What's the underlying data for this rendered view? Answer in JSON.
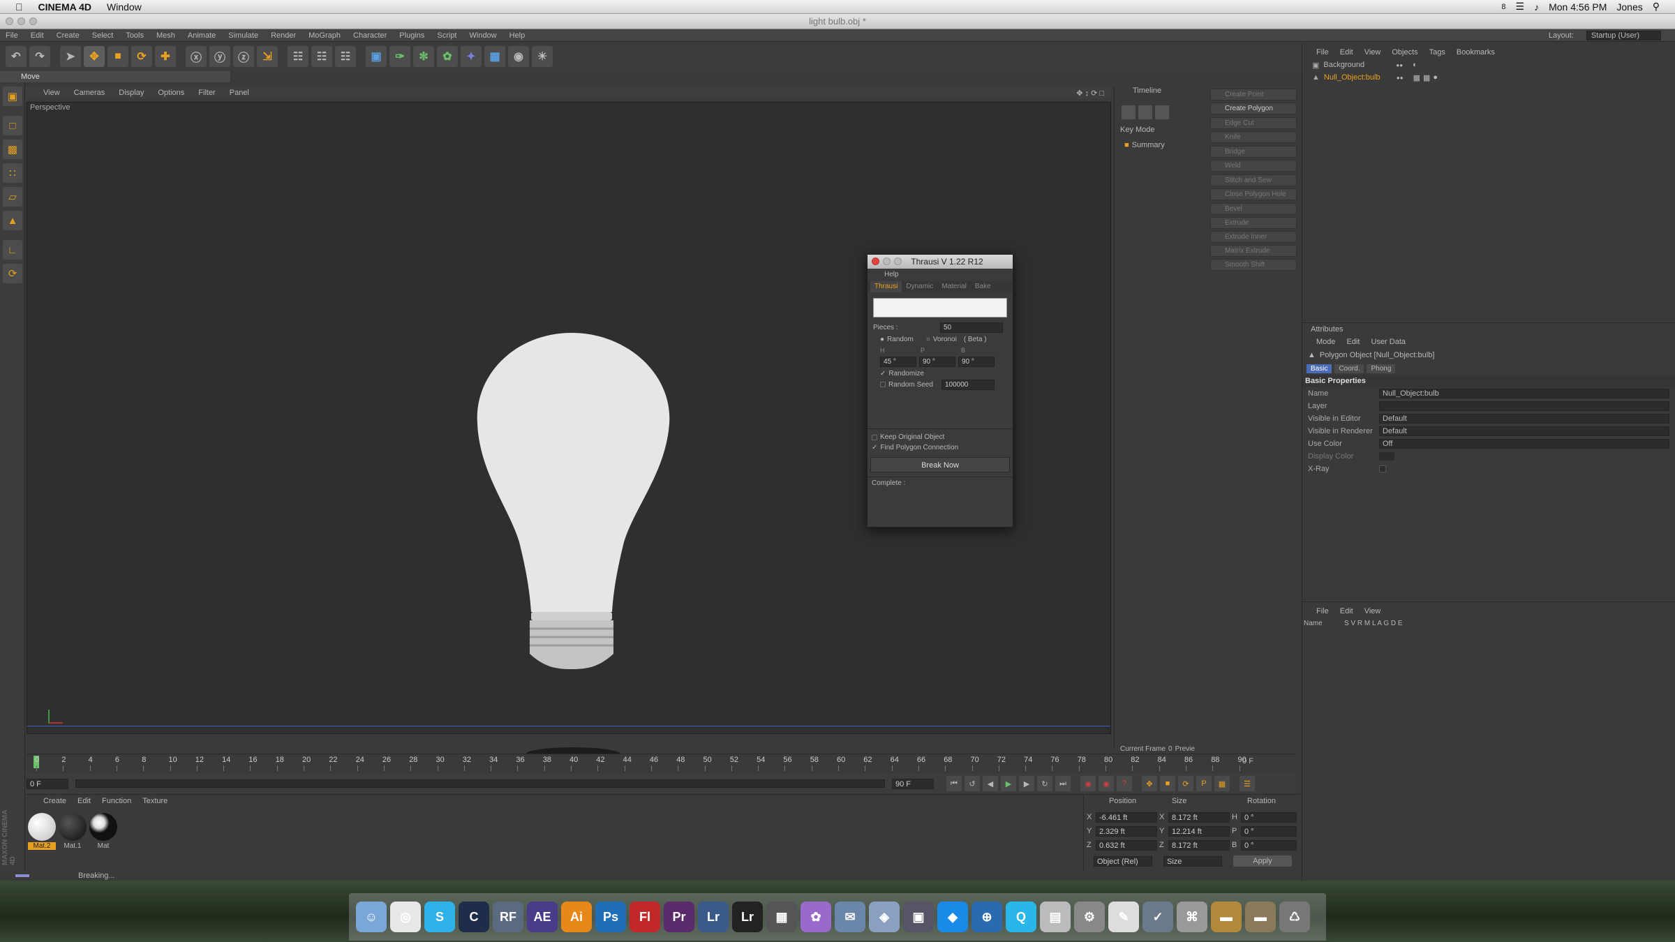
{
  "mac_menubar": {
    "app_name": "CINEMA 4D",
    "window_menu": "Window",
    "time": "Mon 4:56 PM",
    "user": "Jones",
    "badge": "8"
  },
  "window": {
    "title": "light bulb.obj *"
  },
  "app_menu": [
    "File",
    "Edit",
    "Create",
    "Select",
    "Tools",
    "Mesh",
    "Animate",
    "Simulate",
    "Render",
    "MoGraph",
    "Character",
    "Plugins",
    "Script",
    "Window",
    "Help"
  ],
  "layout": {
    "label": "Layout:",
    "value": "Startup (User)"
  },
  "move_label": "Move",
  "viewport": {
    "menu": [
      "View",
      "Cameras",
      "Display",
      "Options",
      "Filter",
      "Panel"
    ],
    "label": "Perspective"
  },
  "timeline_panel": {
    "title": "Timeline",
    "key_mode": "Key Mode",
    "summary": "Summary",
    "current_frame_label": "Current Frame",
    "current_frame_value": "0",
    "preview_label": "Previe"
  },
  "create_panel": {
    "items": [
      "Create Point",
      "Create Polygon",
      "Edge Cut",
      "Knife",
      "Bridge",
      "Weld",
      "Stitch and Sew",
      "Close Polygon Hole",
      "Bevel",
      "Extrude",
      "Extrude Inner",
      "Matrix Extrude",
      "Smooth Shift"
    ]
  },
  "object_manager": {
    "menu": [
      "File",
      "Edit",
      "View",
      "Objects",
      "Tags",
      "Bookmarks"
    ],
    "objects": [
      {
        "name": "Background",
        "selected": false
      },
      {
        "name": "Null_Object:bulb",
        "selected": true
      }
    ]
  },
  "attributes": {
    "title": "Attributes",
    "menu": [
      "Mode",
      "Edit",
      "User Data"
    ],
    "object_label": "Polygon Object [Null_Object:bulb]",
    "tabs": [
      "Basic",
      "Coord.",
      "Phong"
    ],
    "section": "Basic Properties",
    "rows": [
      {
        "label": "Name",
        "value": "Null_Object:bulb"
      },
      {
        "label": "Layer",
        "value": ""
      },
      {
        "label": "Visible in Editor",
        "value": "Default"
      },
      {
        "label": "Visible in Renderer",
        "value": "Default"
      },
      {
        "label": "Use Color",
        "value": "Off"
      },
      {
        "label": "Display Color",
        "value": ""
      },
      {
        "label": "X-Ray",
        "value": ""
      }
    ]
  },
  "layers": {
    "menu": [
      "File",
      "Edit",
      "View"
    ],
    "name_label": "Name",
    "cols": "S V R M L A G D E"
  },
  "timeline": {
    "ticks": [
      "0",
      "2",
      "4",
      "6",
      "8",
      "10",
      "12",
      "14",
      "16",
      "18",
      "20",
      "22",
      "24",
      "26",
      "28",
      "30",
      "32",
      "34",
      "36",
      "38",
      "40",
      "42",
      "44",
      "46",
      "48",
      "50",
      "52",
      "54",
      "56",
      "58",
      "60",
      "62",
      "64",
      "66",
      "68",
      "70",
      "72",
      "74",
      "76",
      "78",
      "80",
      "82",
      "84",
      "86",
      "88",
      "90"
    ],
    "end_frame": "0 F",
    "start_field": "0 F",
    "end_field": "90 F",
    "range_end": "90 F"
  },
  "material_panel": {
    "menu": [
      "Create",
      "Edit",
      "Function",
      "Texture"
    ],
    "materials": [
      {
        "name": "Mat.2",
        "color": "#d8d8d6",
        "selected": true
      },
      {
        "name": "Mat.1",
        "color": "#1a1a1a",
        "selected": false
      },
      {
        "name": "Mat",
        "color": "#2a2a2a",
        "selected": false
      }
    ]
  },
  "coordinates": {
    "headers": [
      "Position",
      "Size",
      "Rotation"
    ],
    "rows": [
      {
        "axis": "X",
        "pos": "-6.461 ft",
        "saxis": "X",
        "size": "8.172 ft",
        "raxis": "H",
        "rot": "0 °"
      },
      {
        "axis": "Y",
        "pos": "2.329 ft",
        "saxis": "Y",
        "size": "12.214 ft",
        "raxis": "P",
        "rot": "0 °"
      },
      {
        "axis": "Z",
        "pos": "0.632 ft",
        "saxis": "Z",
        "size": "8.172 ft",
        "raxis": "B",
        "rot": "0 °"
      }
    ],
    "mode_select": "Object (Rel)",
    "size_select": "Size",
    "apply": "Apply"
  },
  "status_text": "Breaking...",
  "maxon": "MAXON CINEMA 4D",
  "dialog": {
    "title": "Thrausi V 1.22 R12",
    "menu": "Help",
    "tabs": [
      "Thrausi",
      "Dynamic",
      "Material",
      "Bake"
    ],
    "pieces_label": "Pieces :",
    "pieces_value": "50",
    "random_label": "Random",
    "voronoi_label": "Voronoi",
    "beta_label": "( Beta )",
    "hpb_labels": [
      "H",
      "P",
      "B"
    ],
    "hpb_values": [
      "45 °",
      "90 °",
      "90 °"
    ],
    "randomize_label": "Randomize",
    "random_seed_label": "Random Seed",
    "random_seed_value": "100000",
    "keep_original": "Keep Original Object",
    "find_polygon": "Find Polygon Connection",
    "break_now": "Break Now",
    "complete_label": "Complete :"
  },
  "dock": [
    "Finder",
    "Chrome",
    "Skype",
    "Cinema 4D",
    "RF",
    "AE",
    "Ai",
    "Ps",
    "Fl",
    "Pr",
    "Lr",
    "Lr",
    "Clapper",
    "Colors",
    "Mail",
    "Preview",
    "Photo",
    "Dropbox",
    "Safari",
    "QuickTime",
    "Calc",
    "Settings",
    "Notes",
    "Scripts",
    "Capture",
    "Folder",
    "Folder",
    "Trash"
  ],
  "colors": {
    "accent": "#e8a020",
    "selection": "#4a6bb5",
    "viewport_bg": "#2f2f2f"
  }
}
